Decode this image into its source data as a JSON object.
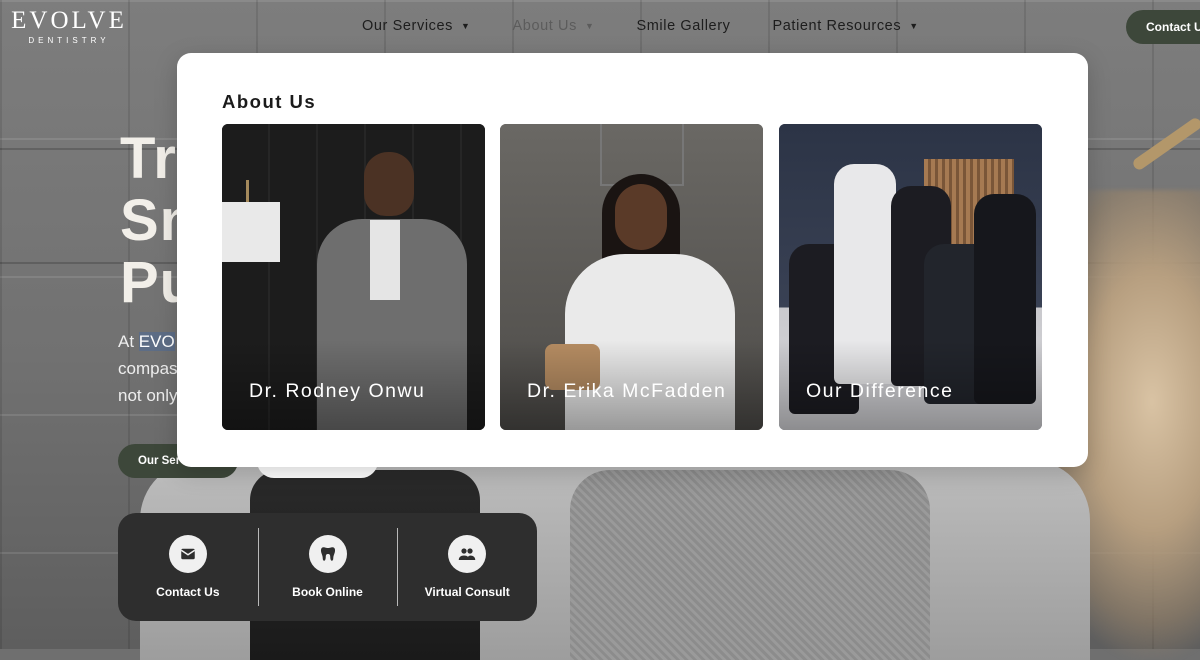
{
  "brand": {
    "logo_main": "EVOLVE",
    "logo_sub": "DENTISTRY"
  },
  "nav": {
    "items": [
      {
        "label": "Our Services",
        "has_dropdown": true
      },
      {
        "label": "About Us",
        "has_dropdown": true,
        "active": true
      },
      {
        "label": "Smile Gallery",
        "has_dropdown": false
      },
      {
        "label": "Patient Resources",
        "has_dropdown": true
      }
    ],
    "contact_button": "Contact Us"
  },
  "hero": {
    "title_lines": [
      "Tr",
      "Sn",
      "Pu"
    ],
    "text_line1_prefix": "At ",
    "text_line1_highlight": "EVO",
    "text_line2": "compas",
    "text_line3": "not only",
    "services_button": "Our Ser"
  },
  "quick_actions": [
    {
      "label": "Contact Us",
      "icon": "envelope-icon"
    },
    {
      "label": "Book Online",
      "icon": "tooth-icon"
    },
    {
      "label": "Virtual Consult",
      "icon": "users-icon"
    }
  ],
  "dropdown": {
    "title": "About Us",
    "cards": [
      {
        "label": "Dr. Rodney Onwu"
      },
      {
        "label": "Dr. Erika McFadden"
      },
      {
        "label": "Our Difference"
      }
    ]
  },
  "colors": {
    "accent_green": "#3d473a",
    "quick_bar": "#2e2e2e",
    "menu_bg": "#ffffff"
  }
}
